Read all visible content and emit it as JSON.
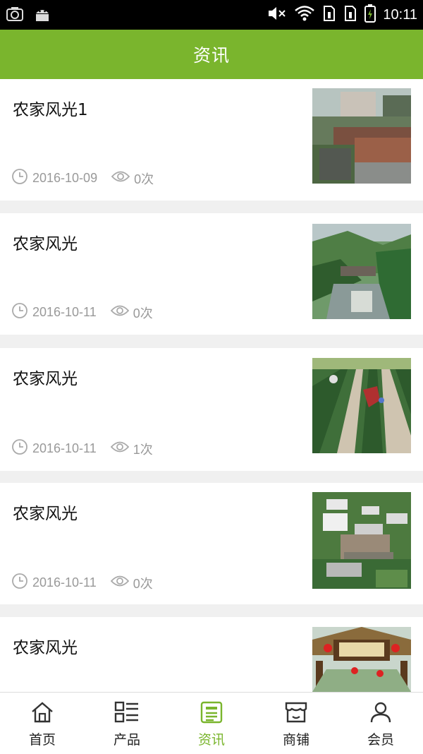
{
  "status_bar": {
    "time": "10:11"
  },
  "header": {
    "title": "资讯"
  },
  "articles": [
    {
      "title": "农家风光1",
      "date": "2016-10-09",
      "views": "0次",
      "thumb": "thumb-1"
    },
    {
      "title": "农家风光",
      "date": "2016-10-11",
      "views": "0次",
      "thumb": "thumb-2"
    },
    {
      "title": "农家风光",
      "date": "2016-10-11",
      "views": "1次",
      "thumb": "thumb-3"
    },
    {
      "title": "农家风光",
      "date": "2016-10-11",
      "views": "0次",
      "thumb": "thumb-4"
    },
    {
      "title": "农家风光",
      "date": "",
      "views": "",
      "thumb": "thumb-5"
    }
  ],
  "tabbar": {
    "active": "资讯",
    "accent_color": "#7ab52d",
    "items": [
      {
        "label": "首页",
        "icon": "home-icon"
      },
      {
        "label": "产品",
        "icon": "list-icon"
      },
      {
        "label": "资讯",
        "icon": "news-icon"
      },
      {
        "label": "商铺",
        "icon": "shop-icon"
      },
      {
        "label": "会员",
        "icon": "user-icon"
      }
    ]
  }
}
